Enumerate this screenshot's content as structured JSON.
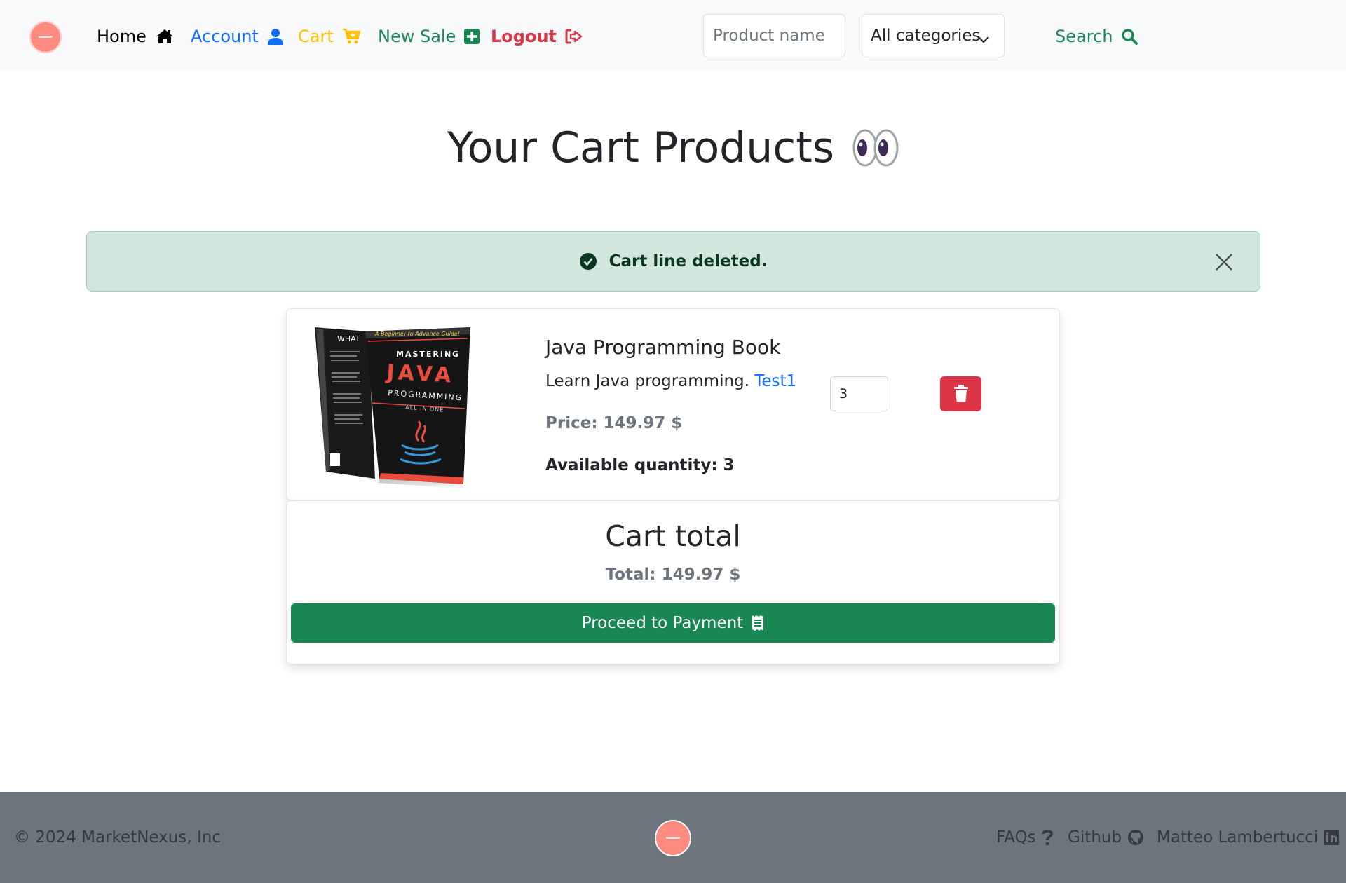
{
  "navbar": {
    "home_label": "Home",
    "account_label": "Account",
    "cart_label": "Cart",
    "new_sale_label": "New Sale",
    "logout_label": "Logout",
    "search_placeholder": "Product name",
    "category_selected": "All categories",
    "search_button_label": "Search"
  },
  "page": {
    "title": "Your Cart Products"
  },
  "alert": {
    "message": "Cart line deleted."
  },
  "cart_item": {
    "name": "Java Programming Book",
    "description": "Learn Java programming.",
    "seller_link": "Test1",
    "price": "Price: 149.97 $",
    "available_quantity": "Available quantity: 3",
    "quantity_value": "3",
    "book_cover": {
      "tagline": "A Beginner to Advance Guide!",
      "line1": "MASTERING",
      "line2": "JAVA",
      "line3": "PROGRAMMING",
      "line4": "ALL IN ONE",
      "back_text": "WHAT"
    }
  },
  "cart_total": {
    "title": "Cart total",
    "total": "Total: 149.97 $",
    "pay_button_label": "Proceed to Payment"
  },
  "footer": {
    "copyright": "© 2024 MarketNexus, Inc",
    "faqs_label": "FAQs",
    "github_label": "Github",
    "linkedin_label": "Matteo Lambertucci"
  },
  "colors": {
    "primary": "#0d6efd",
    "success": "#198754",
    "danger": "#dc3545",
    "warning": "#ffc107",
    "navbar_bg": "#f8f9fa",
    "footer_bg": "#6c757d",
    "alert_bg": "#d1e7dd",
    "logo": "#ff8a80"
  },
  "icons": {
    "home": "house-icon",
    "account": "user-icon",
    "cart": "cart-plus-icon",
    "new_sale": "plus-square-icon",
    "logout": "sign-out-icon",
    "search": "magnifier-icon",
    "category": "chevron-down-icon",
    "alert": "check-circle-icon",
    "close": "close-icon",
    "delete": "trash-icon",
    "payment": "receipt-icon",
    "faqs": "question-icon",
    "github": "github-icon",
    "linkedin": "linkedin-icon",
    "title": "eyes-emoji-icon"
  }
}
